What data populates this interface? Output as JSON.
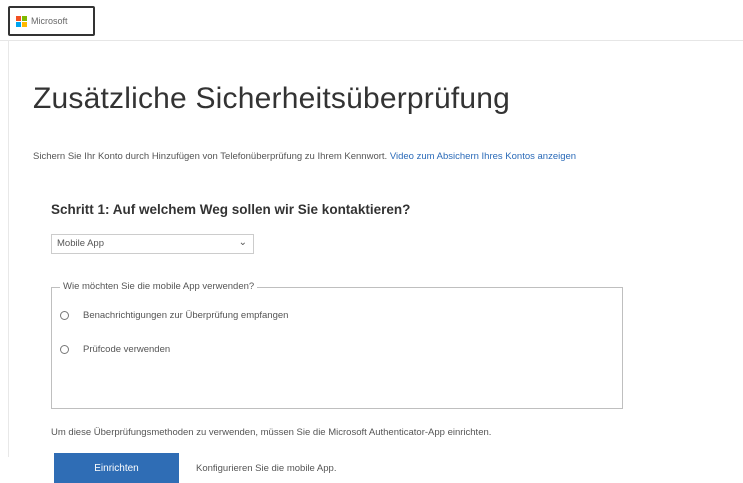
{
  "header": {
    "logo_text": "Microsoft",
    "logo_colors": [
      "#f25022",
      "#7fba00",
      "#00a4ef",
      "#ffb900"
    ]
  },
  "main": {
    "title": "Zusätzliche Sicherheitsüberprüfung",
    "intro_text": "Sichern Sie Ihr Konto durch Hinzufügen von Telefonüberprüfung zu Ihrem Kennwort.",
    "intro_link": "Video zum Absichern Ihres Kontos anzeigen",
    "step_heading": "Schritt 1: Auf welchem Weg sollen wir Sie kontaktieren?",
    "contact_method": {
      "selected": "Mobile App",
      "icon": "chevron-down-icon"
    },
    "app_usage": {
      "legend": "Wie möchten Sie die mobile App verwenden?",
      "options": [
        {
          "label": "Benachrichtigungen zur Überprüfung empfangen",
          "checked": false
        },
        {
          "label": "Prüfcode verwenden",
          "checked": false
        }
      ]
    },
    "setup_note": "Um diese Überprüfungsmethoden zu verwenden, müssen Sie die Microsoft Authenticator-App einrichten.",
    "setup_button": "Einrichten",
    "setup_hint": "Konfigurieren Sie die mobile App."
  },
  "colors": {
    "accent": "#2f6db5",
    "link": "#2a6ab8"
  }
}
